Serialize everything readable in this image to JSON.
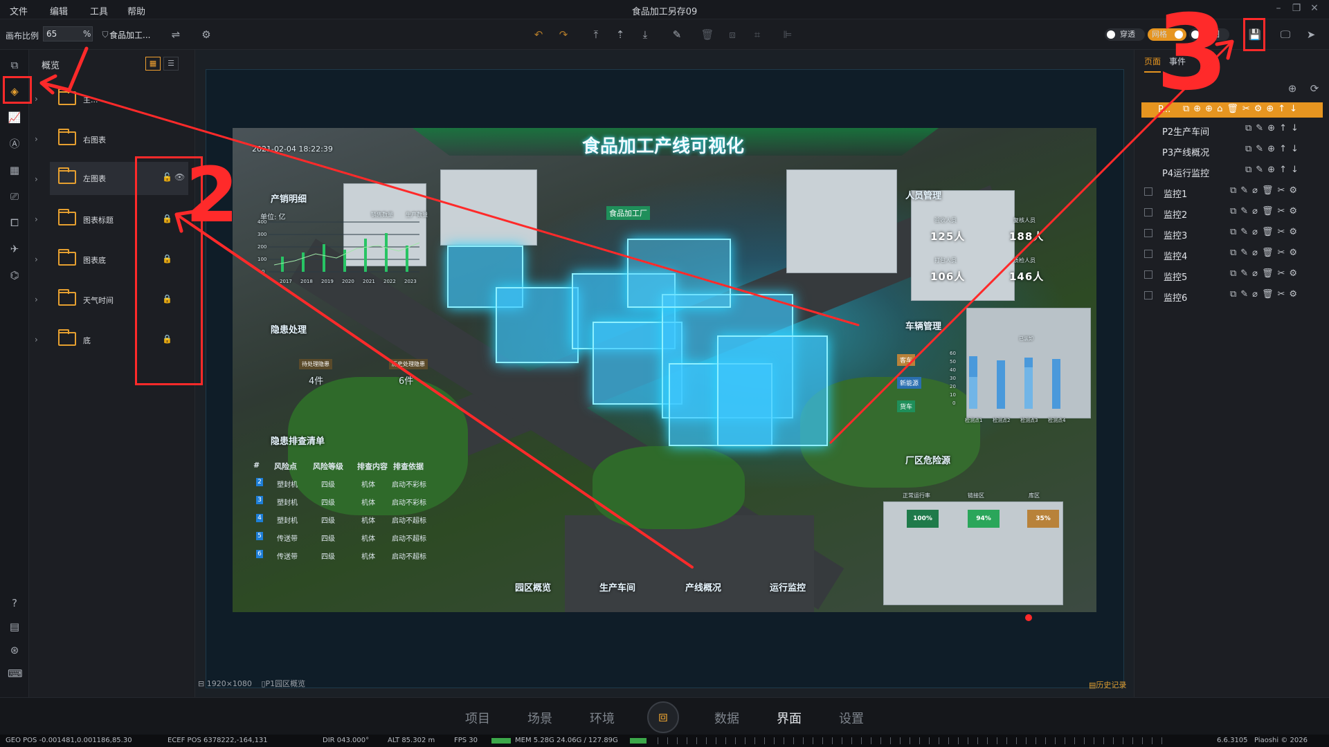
{
  "menubar": {
    "items": [
      "文件",
      "编辑",
      "工具",
      "帮助"
    ],
    "title": "食品加工另存09"
  },
  "toolbar": {
    "zoom_label": "画布比例",
    "zoom_value": "65",
    "zoom_unit": "%",
    "project_name": "食品加工...",
    "toggles": [
      {
        "label": "穿透",
        "on": false
      },
      {
        "label": "网格",
        "on": true
      },
      {
        "label": "蓝图",
        "on": false
      }
    ],
    "accent_color": "#e69520"
  },
  "layers_panel": {
    "title": "概览",
    "rows": [
      {
        "name": "主...",
        "locked": false,
        "visible": false
      },
      {
        "name": "右图表",
        "locked": false,
        "visible": false
      },
      {
        "name": "左图表",
        "locked": true,
        "visible": true,
        "selected": true
      },
      {
        "name": "图表标题",
        "locked": true
      },
      {
        "name": "图表底",
        "locked": true
      },
      {
        "name": "天气时间",
        "locked": true
      },
      {
        "name": "底",
        "locked": true
      }
    ]
  },
  "scene": {
    "title": "食品加工产线可视化",
    "datetime": "2021-02-04 18:22:39",
    "factory_tag": "食品加工厂",
    "prod": {
      "heading": "产销明细",
      "unit": "单位: 亿",
      "legend": [
        "销售数量",
        "生产数量"
      ],
      "y_ticks": [
        "400",
        "300",
        "200",
        "100",
        "0"
      ],
      "x_ticks": [
        "2017",
        "2018",
        "2019",
        "2020",
        "2021",
        "2022",
        "2023"
      ]
    },
    "hazard": {
      "heading": "隐患处理",
      "pending_label": "待处理隐患",
      "pending_value": "4件",
      "history_label": "历史处理隐患",
      "history_value": "6件"
    },
    "checklist": {
      "heading": "隐患排查清单",
      "columns": [
        "#",
        "风险点",
        "风险等级",
        "排查内容",
        "排查依据"
      ],
      "rows": [
        [
          "2",
          "塑封机",
          "四级",
          "机体",
          "启动不彩标"
        ],
        [
          "3",
          "塑封机",
          "四级",
          "机体",
          "启动不彩标"
        ],
        [
          "4",
          "塑封机",
          "四级",
          "机体",
          "启动不超标"
        ],
        [
          "5",
          "传送带",
          "四级",
          "机体",
          "启动不超标"
        ],
        [
          "6",
          "传送带",
          "四级",
          "机体",
          "启动不超标"
        ]
      ]
    },
    "staff": {
      "heading": "人员管理",
      "items": [
        {
          "label": "验收人员",
          "value": "125人"
        },
        {
          "label": "复核人员",
          "value": "188人"
        },
        {
          "label": "打包人员",
          "value": "106人"
        },
        {
          "label": "质检人员",
          "value": "146人"
        }
      ]
    },
    "vehicle": {
      "heading": "车辆管理",
      "tags": [
        "客车",
        "新能源",
        "货车"
      ],
      "legend": [
        "已装卸"
      ],
      "y_ticks": [
        "60",
        "50",
        "40",
        "30",
        "20",
        "10",
        "0"
      ],
      "x_ticks": [
        "检测点1",
        "检测点2",
        "检测点3",
        "检测点4"
      ]
    },
    "danger": {
      "heading": "厂区危险源",
      "items": [
        {
          "label": "正常运行率",
          "value": "100%",
          "color": "#1f7a4a"
        },
        {
          "label": "链接区",
          "value": "94%",
          "color": "#2aa65a"
        },
        {
          "label": "库区",
          "value": "35%",
          "color": "#b8823a"
        }
      ]
    },
    "nav": [
      "园区概览",
      "生产车间",
      "产线概况",
      "运行监控"
    ]
  },
  "canvas_status": {
    "resolution": "1920×1080",
    "page": "P1园区概览",
    "history": "历史记录"
  },
  "right_panel": {
    "tabs": [
      "页面",
      "事件"
    ],
    "pages": [
      {
        "name": "P...",
        "selected": true
      },
      {
        "name": "P2生产车间"
      },
      {
        "name": "P3产线概况"
      },
      {
        "name": "P4运行监控"
      }
    ],
    "monitors": [
      "监控1",
      "监控2",
      "监控3",
      "监控4",
      "监控5",
      "监控6"
    ]
  },
  "bottom_nav": {
    "items": [
      "项目",
      "场景",
      "环境",
      "数据",
      "界面",
      "设置"
    ],
    "active": "界面"
  },
  "footer": {
    "geo_pos": "GEO POS  -0.001481,0.001186,85.30",
    "ecef_pos": "ECEF POS  6378222,-164,131",
    "dir": "DIR  043.000°",
    "alt": "ALT  85.302 m",
    "fps": "FPS  30",
    "mem": "MEM  5.28G  24.06G / 127.89G",
    "version": "6.6.3105",
    "copyright": "Piaoshi © 2026"
  },
  "annotations": [
    "2",
    "3"
  ]
}
